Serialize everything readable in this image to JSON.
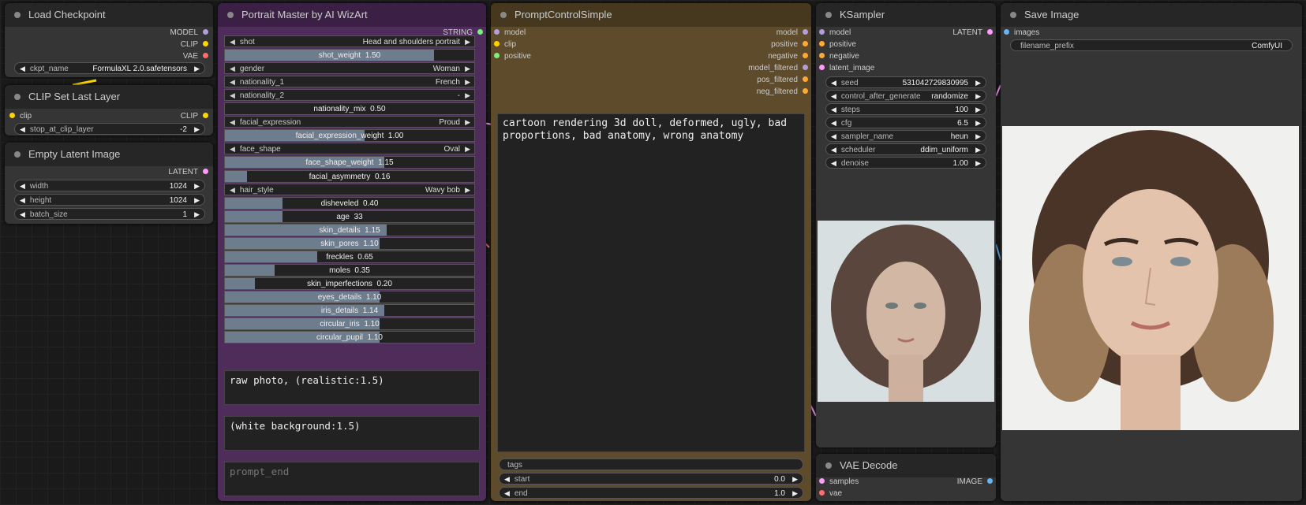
{
  "colors": {
    "model": "#b39ddb",
    "clip": "#ffd500",
    "vae": "#ff6e6e",
    "latent": "#ff9cf9",
    "conditioning": "#ffa931",
    "string": "#7cf07c",
    "image": "#64b5f6"
  },
  "load_checkpoint": {
    "title": "Load Checkpoint",
    "out_model": "MODEL",
    "out_clip": "CLIP",
    "out_vae": "VAE",
    "ckpt_label": "ckpt_name",
    "ckpt_value": "FormulaXL 2.0.safetensors"
  },
  "clip_set_last": {
    "title": "CLIP Set Last Layer",
    "in_clip": "clip",
    "out_clip": "CLIP",
    "stop_label": "stop_at_clip_layer",
    "stop_value": "-2"
  },
  "empty_latent": {
    "title": "Empty Latent Image",
    "out_latent": "LATENT",
    "width_label": "width",
    "width_value": "1024",
    "height_label": "height",
    "height_value": "1024",
    "batch_label": "batch_size",
    "batch_value": "1"
  },
  "portrait": {
    "title": "Portrait Master by AI WizArt",
    "out_string": "STRING",
    "rows": [
      {
        "kind": "combo",
        "label": "shot",
        "value": "Head and shoulders portrait"
      },
      {
        "kind": "slider",
        "label": "shot_weight",
        "value": "1.50",
        "fill": 0.84
      },
      {
        "kind": "combo",
        "label": "gender",
        "value": "Woman"
      },
      {
        "kind": "combo",
        "label": "nationality_1",
        "value": "French"
      },
      {
        "kind": "combo",
        "label": "nationality_2",
        "value": "-"
      },
      {
        "kind": "slider",
        "label": "nationality_mix",
        "value": "0.50",
        "fill": 0.0
      },
      {
        "kind": "combo",
        "label": "facial_expression",
        "value": "Proud"
      },
      {
        "kind": "slider",
        "label": "facial_expression_weight",
        "value": "1.00",
        "fill": 0.56
      },
      {
        "kind": "combo",
        "label": "face_shape",
        "value": "Oval"
      },
      {
        "kind": "slider",
        "label": "face_shape_weight",
        "value": "1.15",
        "fill": 0.64
      },
      {
        "kind": "slider",
        "label": "facial_asymmetry",
        "value": "0.16",
        "fill": 0.09
      },
      {
        "kind": "combo",
        "label": "hair_style",
        "value": "Wavy bob"
      },
      {
        "kind": "slider",
        "label": "disheveled",
        "value": "0.40",
        "fill": 0.23
      },
      {
        "kind": "slider",
        "label": "age",
        "value": "33",
        "fill": 0.23
      },
      {
        "kind": "slider",
        "label": "skin_details",
        "value": "1.15",
        "fill": 0.65
      },
      {
        "kind": "slider",
        "label": "skin_pores",
        "value": "1.10",
        "fill": 0.62
      },
      {
        "kind": "slider",
        "label": "freckles",
        "value": "0.65",
        "fill": 0.37
      },
      {
        "kind": "slider",
        "label": "moles",
        "value": "0.35",
        "fill": 0.2
      },
      {
        "kind": "slider",
        "label": "skin_imperfections",
        "value": "0.20",
        "fill": 0.12
      },
      {
        "kind": "slider",
        "label": "eyes_details",
        "value": "1.10",
        "fill": 0.62
      },
      {
        "kind": "slider",
        "label": "iris_details",
        "value": "1.14",
        "fill": 0.64
      },
      {
        "kind": "slider",
        "label": "circular_iris",
        "value": "1.10",
        "fill": 0.62
      },
      {
        "kind": "slider",
        "label": "circular_pupil",
        "value": "1.10",
        "fill": 0.62
      }
    ],
    "prompt_start": "raw photo, (realistic:1.5)",
    "prompt_additional": "(white background:1.5)",
    "prompt_end_placeholder": "prompt_end"
  },
  "pcs": {
    "title": "PromptControlSimple",
    "in_model": "model",
    "in_clip": "clip",
    "in_positive": "positive",
    "out_model": "model",
    "out_positive": "positive",
    "out_negative": "negative",
    "out_model_filtered": "model_filtered",
    "out_pos_filtered": "pos_filtered",
    "out_neg_filtered": "neg_filtered",
    "negative_text": "cartoon rendering 3d doll, deformed, ugly, bad proportions, bad anatomy, wrong anatomy",
    "tags_label": "tags",
    "start_label": "start",
    "start_value": "0.0",
    "end_label": "end",
    "end_value": "1.0"
  },
  "ksampler": {
    "title": "KSampler",
    "in_model": "model",
    "in_positive": "positive",
    "in_negative": "negative",
    "in_latent": "latent_image",
    "out_latent": "LATENT",
    "widgets": [
      {
        "label": "seed",
        "value": "531042729830995"
      },
      {
        "label": "control_after_generate",
        "value": "randomize"
      },
      {
        "label": "steps",
        "value": "100"
      },
      {
        "label": "cfg",
        "value": "6.5"
      },
      {
        "label": "sampler_name",
        "value": "heun"
      },
      {
        "label": "scheduler",
        "value": "ddim_uniform"
      },
      {
        "label": "denoise",
        "value": "1.00"
      }
    ]
  },
  "vae_decode": {
    "title": "VAE Decode",
    "in_samples": "samples",
    "in_vae": "vae",
    "out_image": "IMAGE"
  },
  "save_image": {
    "title": "Save Image",
    "in_images": "images",
    "prefix_label": "filename_prefix",
    "prefix_value": "ComfyUI"
  }
}
